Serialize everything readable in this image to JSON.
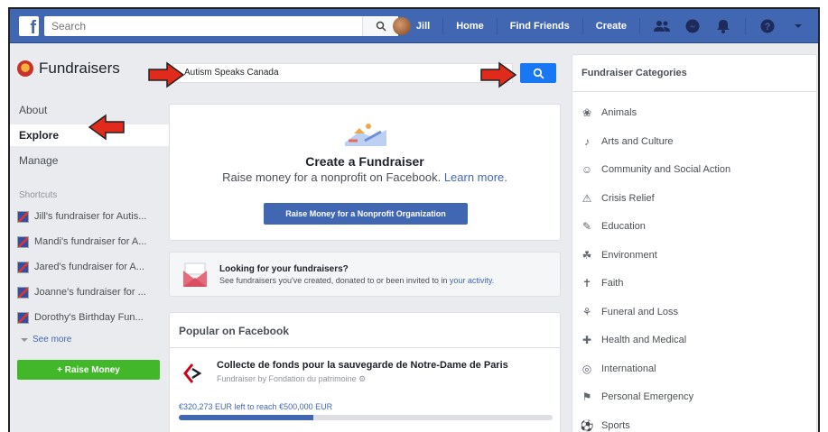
{
  "colors": {
    "brand": "#4267b2",
    "green": "#42b72a",
    "annotation": "#e02a1c"
  },
  "topbar": {
    "search_placeholder": "Search",
    "user_name": "Jill",
    "links": [
      "Home",
      "Find Friends",
      "Create"
    ],
    "icons": [
      "friends-icon",
      "messenger-icon",
      "notifications-icon",
      "help-icon",
      "chevron-down-icon"
    ]
  },
  "left": {
    "title": "Fundraisers",
    "nav": [
      {
        "label": "About",
        "active": false
      },
      {
        "label": "Explore",
        "active": true
      },
      {
        "label": "Manage",
        "active": false
      }
    ],
    "shortcuts_header": "Shortcuts",
    "shortcuts": [
      "Jill's fundraiser for Autis...",
      "Mandi's fundraiser for A...",
      "Jared's fundraiser for A...",
      "Joanne's fundraiser for ...",
      "Dorothy's Birthday Fun..."
    ],
    "see_more": "See more",
    "raise_money_btn": "+ Raise Money"
  },
  "middle": {
    "search_value": "Autism Speaks Canada",
    "create": {
      "title": "Create a Fundraiser",
      "subtitle": "Raise money for a nonprofit on Facebook.",
      "learn_more": "Learn more.",
      "button": "Raise Money for a Nonprofit Organization"
    },
    "looking": {
      "title": "Looking for your fundraisers?",
      "subtitle": "See fundraisers you've created, donated to or been invited to in",
      "link": "your activity."
    },
    "popular": {
      "header": "Popular on Facebook",
      "item_title": "Collecte de fonds pour la sauvegarde de Notre-Dame de Paris",
      "item_sub": "Fundraiser by Fondation du patrimoine",
      "progress_text": "€320,273 EUR left to reach €500,000 EUR",
      "progress_fraction": 0.36
    }
  },
  "right": {
    "header": "Fundraiser Categories",
    "categories": [
      {
        "label": "Animals",
        "icon": "animals-icon"
      },
      {
        "label": "Arts and Culture",
        "icon": "arts-icon"
      },
      {
        "label": "Community and Social Action",
        "icon": "community-icon"
      },
      {
        "label": "Crisis Relief",
        "icon": "crisis-icon"
      },
      {
        "label": "Education",
        "icon": "education-icon"
      },
      {
        "label": "Environment",
        "icon": "environment-icon"
      },
      {
        "label": "Faith",
        "icon": "faith-icon"
      },
      {
        "label": "Funeral and Loss",
        "icon": "funeral-icon"
      },
      {
        "label": "Health and Medical",
        "icon": "health-icon"
      },
      {
        "label": "International",
        "icon": "globe-icon"
      },
      {
        "label": "Personal Emergency",
        "icon": "emergency-icon"
      },
      {
        "label": "Sports",
        "icon": "sports-icon"
      }
    ]
  }
}
